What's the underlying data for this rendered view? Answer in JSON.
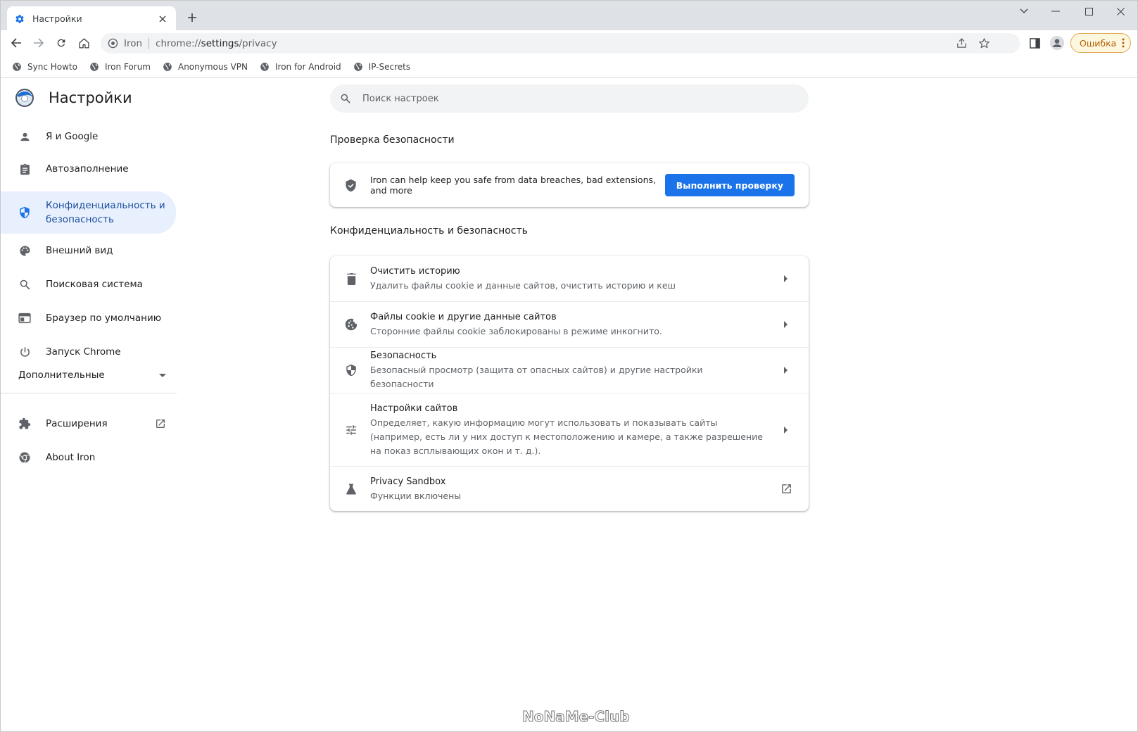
{
  "tab": {
    "title": "Настройки",
    "icon": "gear-icon"
  },
  "toolbar": {
    "site_name": "Iron",
    "url_scheme": "chrome://",
    "url_host": "settings",
    "url_path": "/privacy",
    "error_chip": "Ошибка"
  },
  "bookmarks": [
    {
      "label": "Sync Howto"
    },
    {
      "label": "Iron Forum"
    },
    {
      "label": "Anonymous VPN"
    },
    {
      "label": "Iron for Android"
    },
    {
      "label": "IP-Secrets"
    }
  ],
  "app": {
    "title": "Настройки"
  },
  "sidebar": {
    "items": [
      {
        "label": "Я и Google",
        "icon": "person-icon"
      },
      {
        "label": "Автозаполнение",
        "icon": "clipboard-icon"
      },
      {
        "label": "Конфиденциальность и безопасность",
        "icon": "shield-icon"
      },
      {
        "label": "Внешний вид",
        "icon": "palette-icon"
      },
      {
        "label": "Поисковая система",
        "icon": "search-icon"
      },
      {
        "label": "Браузер по умолчанию",
        "icon": "browser-window-icon"
      },
      {
        "label": "Запуск Chrome",
        "icon": "power-icon"
      }
    ],
    "advanced": "Дополнительные",
    "extensions": "Расширения",
    "about": "About Iron"
  },
  "search": {
    "placeholder": "Поиск настроек"
  },
  "safety_check": {
    "title": "Проверка безопасности",
    "text": "Iron can help keep you safe from data breaches, bad extensions, and more",
    "button": "Выполнить проверку"
  },
  "privacy": {
    "title": "Конфиденциальность и безопасность",
    "rows": [
      {
        "title": "Очистить историю",
        "subtitle": "Удалить файлы cookie и данные сайтов, очистить историю и кеш",
        "icon": "trash-icon"
      },
      {
        "title": "Файлы cookie и другие данные сайтов",
        "subtitle": "Сторонние файлы cookie заблокированы в режиме инкогнито.",
        "icon": "cookie-icon"
      },
      {
        "title": "Безопасность",
        "subtitle": "Безопасный просмотр (защита от опасных сайтов) и другие настройки безопасности",
        "icon": "security-shield-icon"
      },
      {
        "title": "Настройки сайтов",
        "subtitle": "Определяет, какую информацию могут использовать и показывать сайты (например, есть ли у них доступ к местоположению и камере, а также разрешение на показ всплывающих окон и т. д.).",
        "icon": "tune-icon"
      },
      {
        "title": "Privacy Sandbox",
        "subtitle": "Функции включены",
        "icon": "flask-icon"
      }
    ]
  },
  "watermark": "NoNaMe-Club",
  "colors": {
    "accent": "#1a73e8",
    "active_bg": "#e8f0fe",
    "active_text": "#1a4d9e"
  }
}
